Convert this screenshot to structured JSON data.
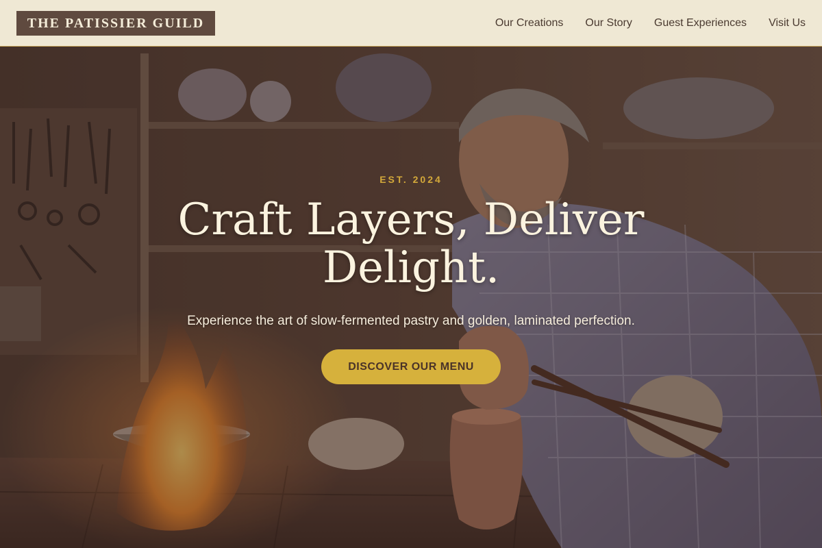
{
  "brand": {
    "name": "THE PATISSIER GUILD"
  },
  "nav": {
    "items": [
      {
        "label": "Our Creations"
      },
      {
        "label": "Our Story"
      },
      {
        "label": "Guest Experiences"
      },
      {
        "label": "Visit Us"
      }
    ]
  },
  "hero": {
    "eyebrow": "EST. 2024",
    "headline": "Craft Layers, Deliver Delight.",
    "subhead": "Experience the art of slow-fermented pastry and golden, laminated perfection.",
    "cta_label": "DISCOVER OUR MENU",
    "photo_description": "artisan"
  },
  "colors": {
    "header_bg": "#efe8d4",
    "logo_bg": "#5f4a3f",
    "accent_gold": "#d6b13c",
    "eyebrow_gold": "#d4a93a",
    "headline_cream": "#fbf3df"
  }
}
